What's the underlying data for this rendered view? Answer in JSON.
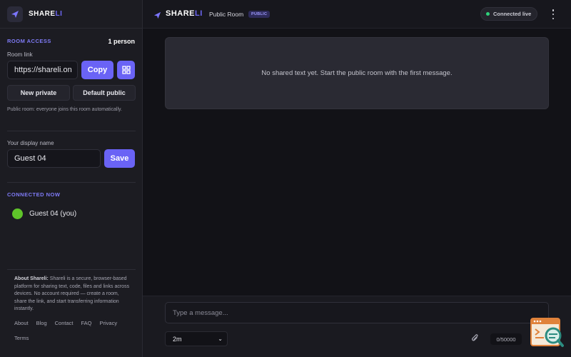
{
  "app": {
    "brand_part1": "SHARE",
    "brand_part2": "LI"
  },
  "sidebar": {
    "room_access_title": "ROOM ACCESS",
    "person_count": "1 person",
    "room_link_label": "Room link",
    "room_link_value": "https://shareli.on",
    "copy_label": "Copy",
    "qr_icon": "qr-code-icon",
    "new_private_label": "New private",
    "default_public_label": "Default public",
    "public_room_help": "Public room: everyone joins this room automatically.",
    "display_name_label": "Your display name",
    "display_name_value": "Guest 04",
    "save_label": "Save",
    "connected_title": "CONNECTED NOW",
    "connected_users": [
      {
        "name": "Guest 04 (you)",
        "color": "#5fc42a"
      }
    ],
    "about_title": "About Shareli:",
    "about_text": " Shareli is a secure, browser-based platform for sharing text, code, files and links across devices. No account required — create a room, share the link, and start transferring information instantly.",
    "footer_links": [
      "About",
      "Blog",
      "Contact",
      "FAQ",
      "Privacy"
    ],
    "terms_label": "Terms"
  },
  "header": {
    "brand_part1": "SHARE",
    "brand_part2": "LI",
    "room_name": "Public Room",
    "room_badge": "PUBLIC",
    "status_text": "Connected live",
    "status_color": "#2fd07a"
  },
  "main": {
    "empty_message": "No shared text yet. Start the public room with the first message."
  },
  "composer": {
    "placeholder": "Type a message...",
    "expiry_value": "2m",
    "char_counter": "0/50000"
  },
  "colors": {
    "accent": "#6a63f5",
    "background": "#121217",
    "sidebar": "#1c1c22"
  }
}
